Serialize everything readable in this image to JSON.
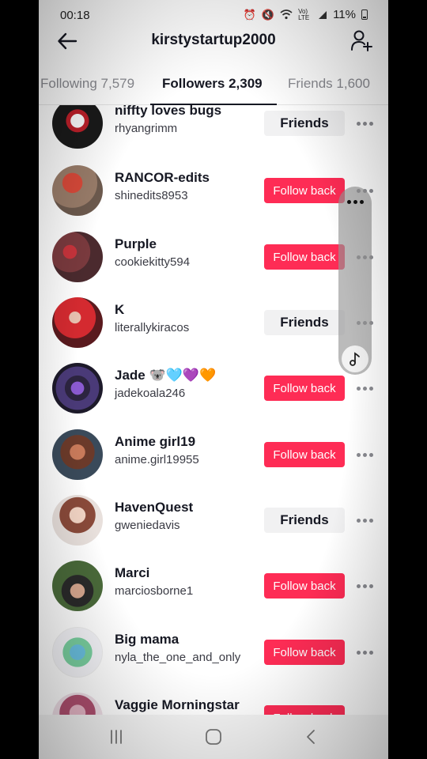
{
  "status": {
    "time": "00:18",
    "network": "Vo) LTE",
    "battery": "11%"
  },
  "header": {
    "title": "kirstystartup2000"
  },
  "tabs": [
    {
      "label": "Following 7,579"
    },
    {
      "label": "Followers 2,309"
    },
    {
      "label": "Friends 1,600"
    }
  ],
  "followers": [
    {
      "name": "niffty loves bugs",
      "username": "rhyangrimm",
      "button": "Friends"
    },
    {
      "name": "RANCOR-edits",
      "username": "shinedits8953",
      "button": "Follow back"
    },
    {
      "name": "Purple",
      "username": "cookiekitty594",
      "button": "Follow back"
    },
    {
      "name": "K",
      "username": "literallykiracos",
      "button": "Friends"
    },
    {
      "name": "Jade 🐨🩵💜🧡",
      "username": "jadekoala246",
      "button": "Follow back"
    },
    {
      "name": "Anime girl19",
      "username": "anime.girl19955",
      "button": "Follow back"
    },
    {
      "name": "HavenQuest",
      "username": "gweniedavis",
      "button": "Friends"
    },
    {
      "name": "Marci",
      "username": "marciosborne1",
      "button": "Follow back"
    },
    {
      "name": "Big mama",
      "username": "nyla_the_one_and_only",
      "button": "Follow back"
    },
    {
      "name": "Vaggie Morningstar",
      "username": "",
      "button": "Follow back"
    }
  ],
  "colors": {
    "follow_back": "#fe2c55",
    "friends_bg": "#f1f1f2",
    "text_primary": "#161823"
  },
  "icons": {
    "back": "back-arrow-icon",
    "add_user": "add-user-icon",
    "more": "more-icon",
    "music": "music-note-icon"
  }
}
